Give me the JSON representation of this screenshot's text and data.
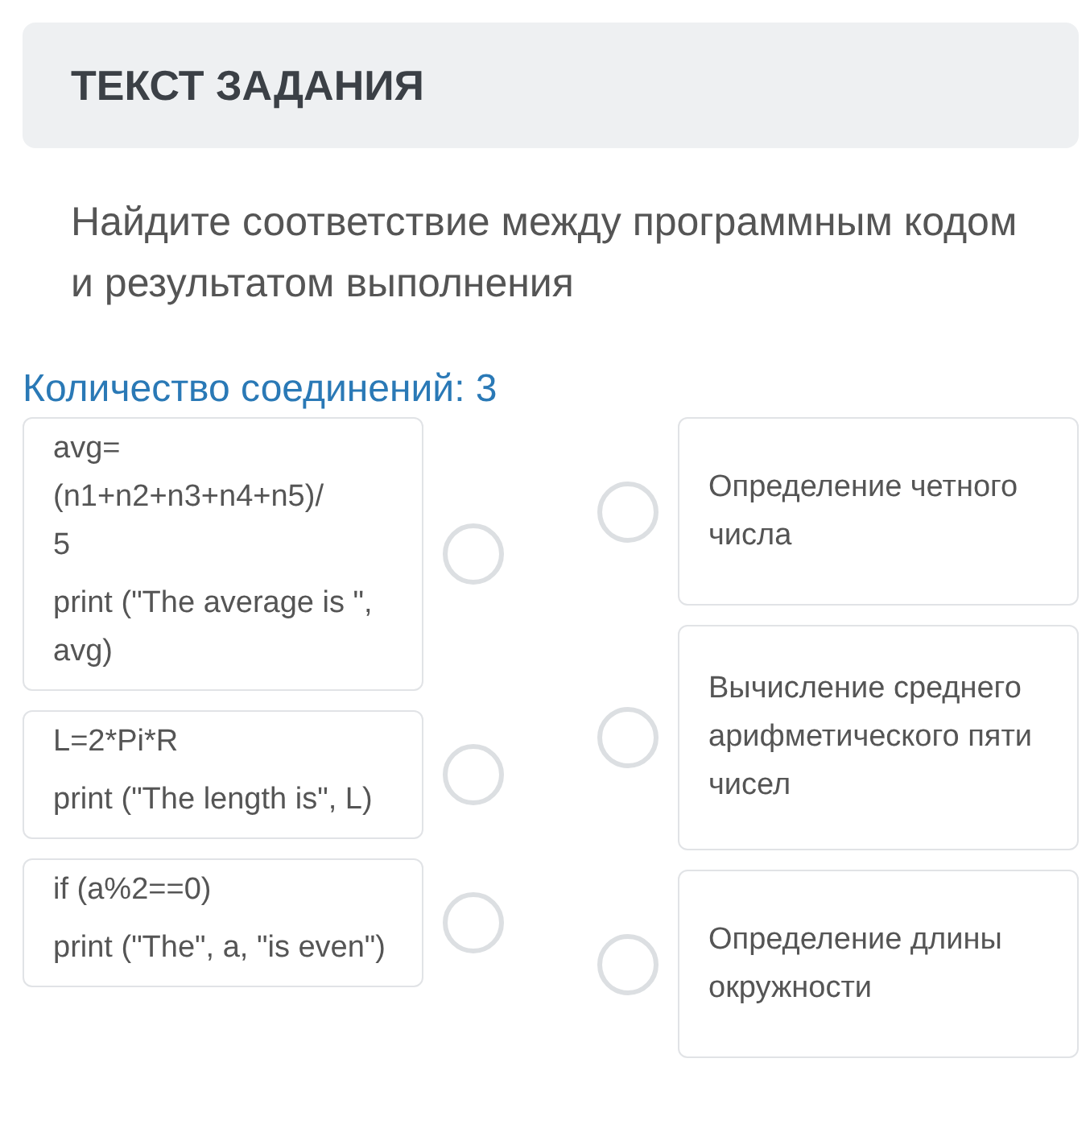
{
  "header": {
    "title": "ТЕКСТ ЗАДАНИЯ"
  },
  "instruction": "Найдите соответствие между программным кодом и результатом выполнения",
  "connections_label": "Количество соединений: 3",
  "left_items": [
    {
      "lines": [
        "avg=\n(n1+n2+n3+n4+n5)/\n5",
        "print (\"The average is \", avg)"
      ],
      "selected": false
    },
    {
      "lines": [
        "L=2*Pi*R",
        "print (\"The length is\", L)"
      ],
      "selected": false
    },
    {
      "lines": [
        "if (a%2==0)",
        "print (\"The\", a, \"is even\")"
      ],
      "selected": false
    }
  ],
  "right_items": [
    {
      "text": "Определение четного числа",
      "selected": false
    },
    {
      "text": "Вычисление среднего арифметического пяти чисел",
      "selected": false
    },
    {
      "text": "Определение длины окружности",
      "selected": false
    }
  ]
}
